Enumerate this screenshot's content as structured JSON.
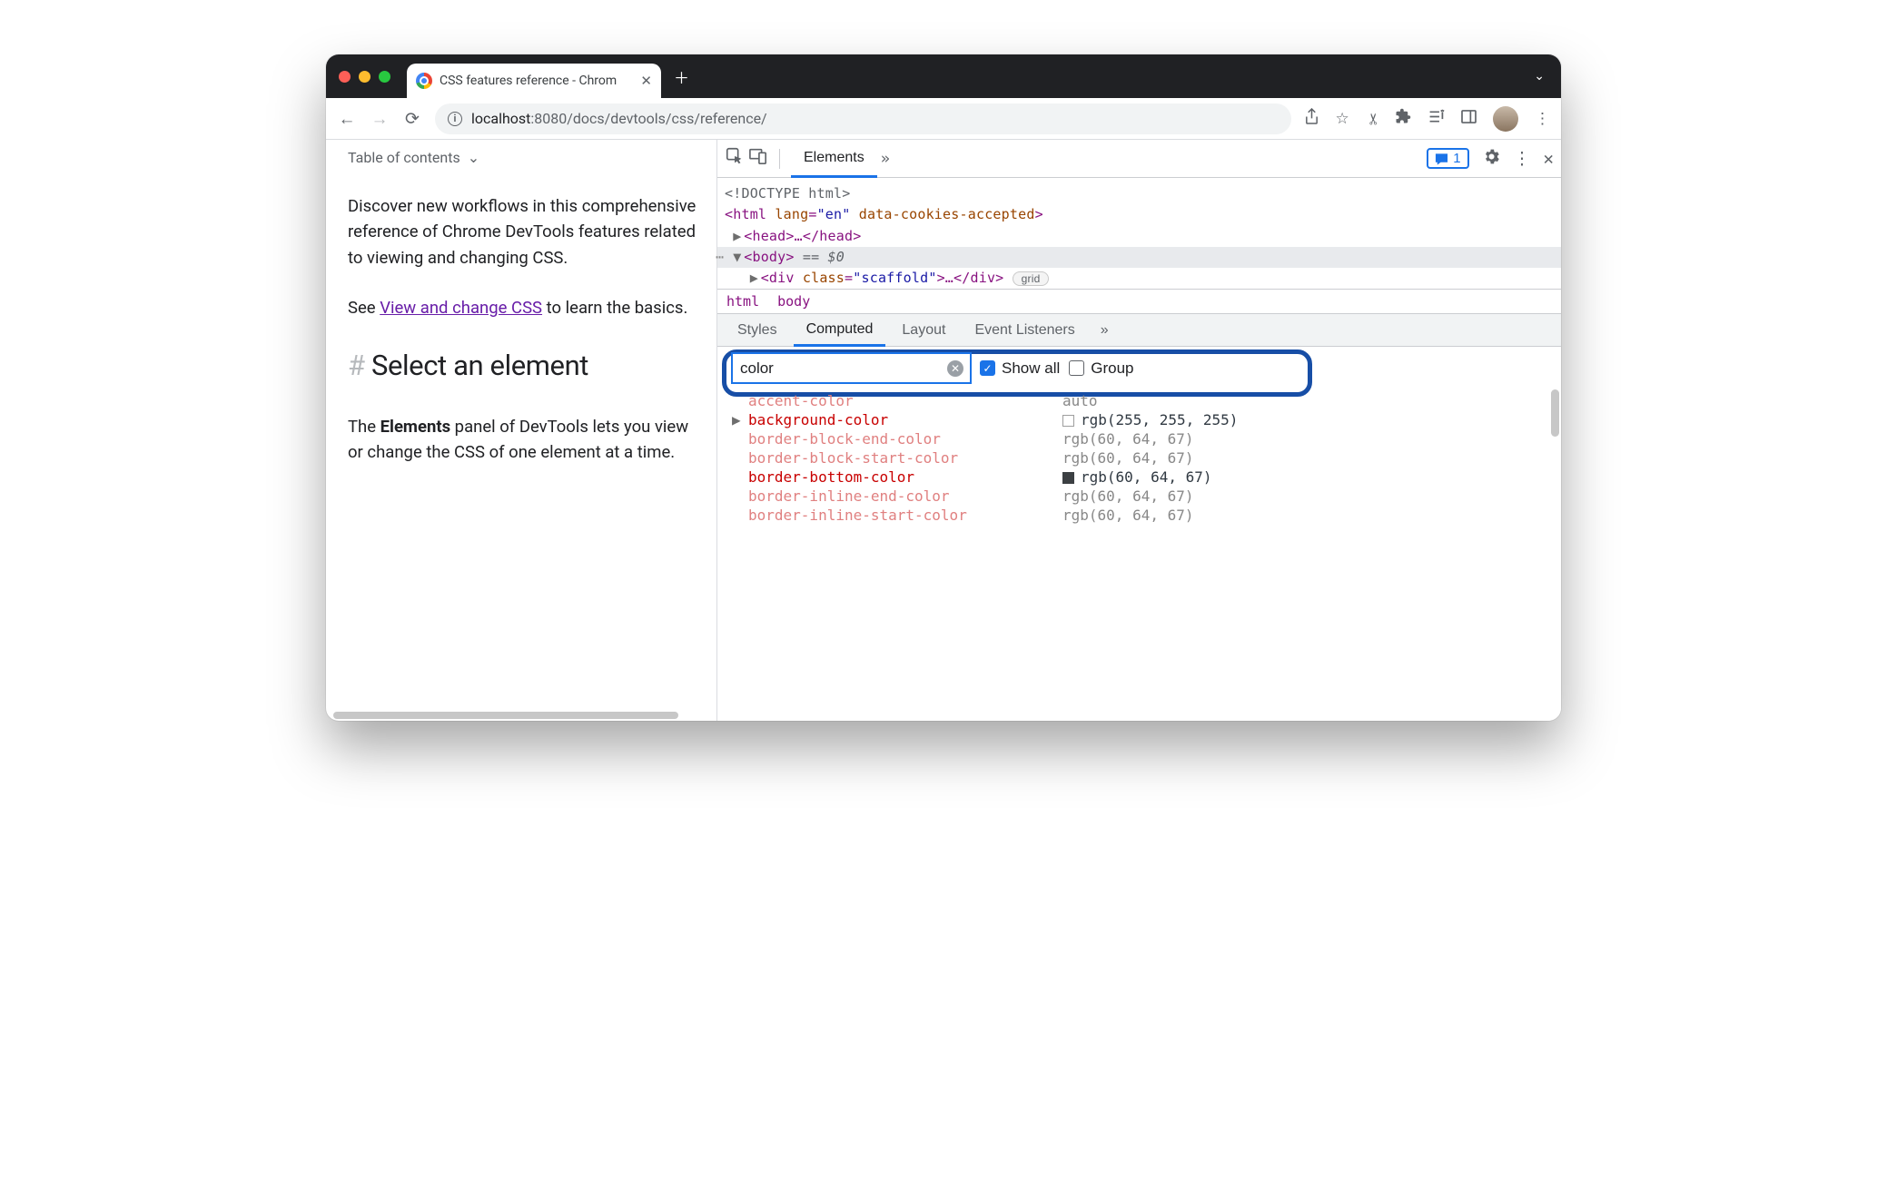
{
  "browser": {
    "tab_title": "CSS features reference - Chrom",
    "url_host": "localhost",
    "url_port": ":8080",
    "url_path": "/docs/devtools/css/reference/"
  },
  "page": {
    "toc_label": "Table of contents",
    "intro": "Discover new workflows in this comprehensive reference of Chrome DevTools features related to viewing and changing CSS.",
    "see_prefix": "See ",
    "see_link": "View and change CSS",
    "see_suffix": " to learn the basics.",
    "heading": "Select an element",
    "para2_a": "The ",
    "para2_b": "Elements",
    "para2_c": " panel of DevTools lets you view or change the CSS of one element at a time."
  },
  "devtools": {
    "tabs": {
      "elements": "Elements"
    },
    "issues_count": "1",
    "dom": {
      "doctype": "<!DOCTYPE html>",
      "html_open_a": "<html ",
      "html_lang_k": "lang",
      "html_lang_v": "\"en\"",
      "html_dc": "data-cookies-accepted",
      "html_close": ">",
      "head": "<head>…</head>",
      "body": "<body>",
      "body_suffix": " == $0",
      "div_a": "<div ",
      "div_class_k": "class",
      "div_class_v": "\"scaffold\"",
      "div_b": ">…</div>",
      "grid_badge": "grid"
    },
    "crumbs": {
      "html": "html",
      "body": "body"
    },
    "subtabs": {
      "styles": "Styles",
      "computed": "Computed",
      "layout": "Layout",
      "listeners": "Event Listeners"
    },
    "filter": {
      "value": "color",
      "show_all": "Show all",
      "group": "Group"
    },
    "props": [
      {
        "name": "accent-color",
        "value": "auto",
        "muted": true
      },
      {
        "name": "background-color",
        "value": "rgb(255, 255, 255)",
        "expandable": true,
        "swatch": "white"
      },
      {
        "name": "border-block-end-color",
        "value": "rgb(60, 64, 67)",
        "muted": true
      },
      {
        "name": "border-block-start-color",
        "value": "rgb(60, 64, 67)",
        "muted": true
      },
      {
        "name": "border-bottom-color",
        "value": "rgb(60, 64, 67)",
        "swatch": "gray"
      },
      {
        "name": "border-inline-end-color",
        "value": "rgb(60, 64, 67)",
        "muted": true
      },
      {
        "name": "border-inline-start-color",
        "value": "rgb(60, 64, 67)",
        "muted": true
      }
    ]
  }
}
